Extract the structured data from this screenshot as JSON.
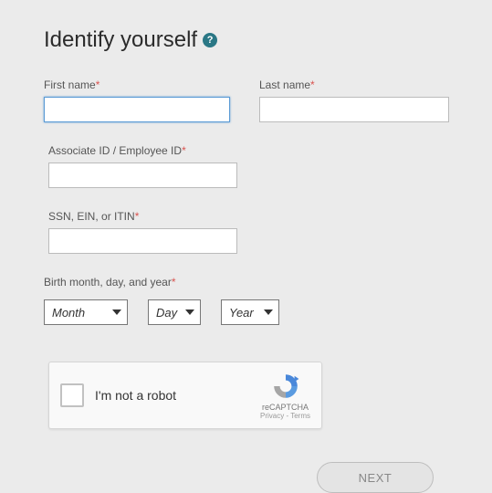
{
  "heading": "Identify yourself",
  "labels": {
    "firstName": "First name",
    "lastName": "Last name",
    "associateId": "Associate ID / Employee ID",
    "ssn": "SSN, EIN, or ITIN",
    "birth": "Birth month, day, and year"
  },
  "required": "*",
  "values": {
    "firstName": "",
    "lastName": "",
    "associateId": "",
    "ssn": ""
  },
  "birthSelects": {
    "month": "Month",
    "day": "Day",
    "year": "Year"
  },
  "recaptcha": {
    "text": "I'm not a robot",
    "brand": "reCAPTCHA",
    "links": "Privacy - Terms"
  },
  "button": {
    "next": "NEXT"
  }
}
